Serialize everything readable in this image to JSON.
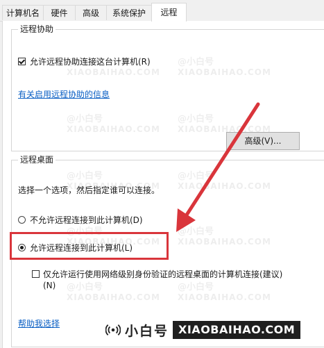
{
  "tabs": [
    {
      "label": "计算机名"
    },
    {
      "label": "硬件"
    },
    {
      "label": "高级"
    },
    {
      "label": "系统保护"
    },
    {
      "label": "远程"
    }
  ],
  "remote_assistance": {
    "title": "远程协助",
    "allow_checkbox": {
      "label": "允许远程协助连接这台计算机(R)",
      "checked": true
    },
    "info_link": "有关启用远程协助的信息",
    "advanced_button": "高级(V)..."
  },
  "remote_desktop": {
    "title": "远程桌面",
    "instruction": "选择一个选项，然后指定谁可以连接。",
    "options": [
      {
        "label": "不允许远程连接到此计算机(D)",
        "selected": false
      },
      {
        "label": "允许远程连接到此计算机(L)",
        "selected": true
      }
    ],
    "nla_checkbox": {
      "label_line1": "仅允许运行使用网络级别身份验证的远程桌面的计算机连接(建议)",
      "label_line2": "(N)",
      "checked": false
    },
    "help_link": "帮助我选择"
  },
  "watermark": {
    "cn": "@小白号",
    "en": "XIAOBAIHAO.COM"
  },
  "brand": {
    "cn": "小白号",
    "en": "XIAOBAIHAO.COM"
  },
  "colors": {
    "highlight_red": "#d9353b",
    "link_blue": "#0a5fc4"
  }
}
